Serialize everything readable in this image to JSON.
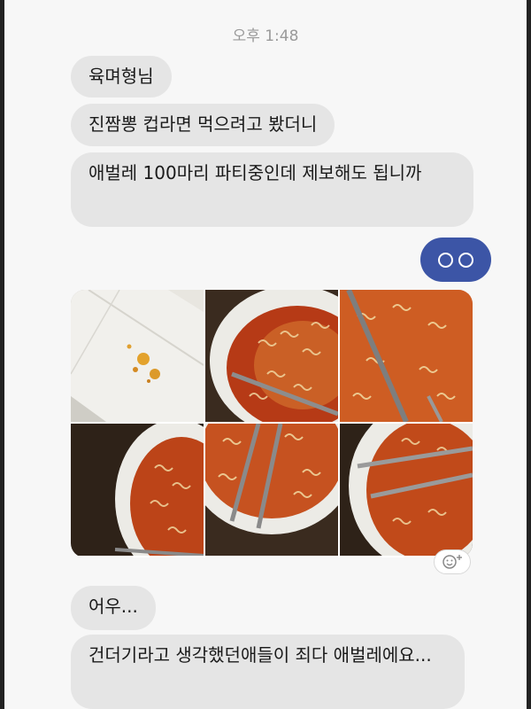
{
  "chat": {
    "timestamp": "오후 1:48",
    "messages": [
      {
        "text": "육며형님"
      },
      {
        "text": "진짬뽕 컵라면 먹으려고 봤더니"
      },
      {
        "text": "애벌레 100마리 파티중인데 제보해도 됩니까"
      },
      {
        "text": "어우..."
      },
      {
        "text": "건더기라고 생각했던애들이 죄다 애벌레에요..."
      }
    ],
    "sent_icon": "oo-emoticon",
    "photos": [
      {
        "name": "photo-tissue-larvae"
      },
      {
        "name": "photo-bowl-closeup"
      },
      {
        "name": "photo-bowl-chopsticks"
      },
      {
        "name": "photo-bowl-side"
      },
      {
        "name": "photo-bowl-chopsticks-vertical"
      },
      {
        "name": "photo-bowl-chopsticks-angled"
      }
    ],
    "reaction_icon": "add-reaction-icon"
  }
}
